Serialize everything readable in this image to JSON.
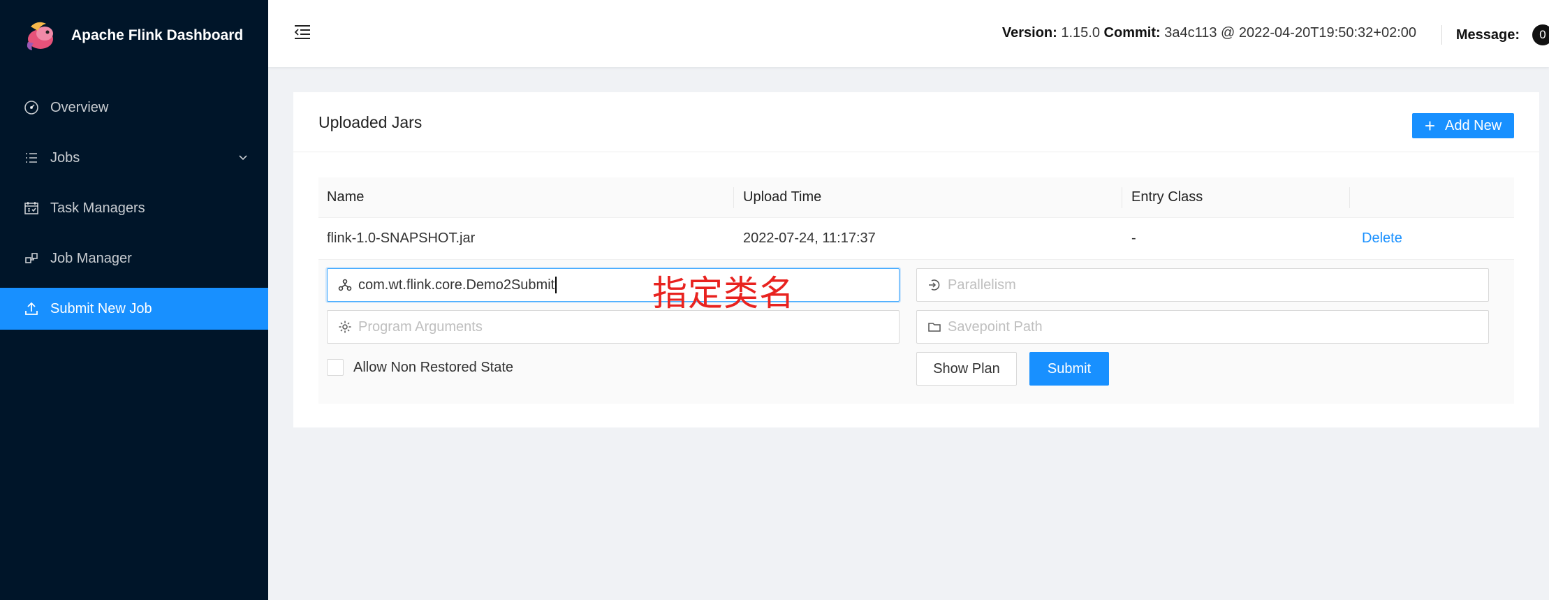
{
  "app": {
    "title": "Apache Flink Dashboard"
  },
  "sidebar": {
    "items": [
      {
        "label": "Overview",
        "icon": "dashboard-icon"
      },
      {
        "label": "Jobs",
        "icon": "list-icon"
      },
      {
        "label": "Task Managers",
        "icon": "schedule-icon"
      },
      {
        "label": "Job Manager",
        "icon": "cluster-icon"
      },
      {
        "label": "Submit New Job",
        "icon": "upload-icon"
      }
    ]
  },
  "header": {
    "version_label": "Version:",
    "version_value": "1.15.0",
    "commit_label": "Commit:",
    "commit_value": "3a4c113 @ 2022-04-20T19:50:32+02:00",
    "message_label": "Message:",
    "message_count": "0"
  },
  "card": {
    "title": "Uploaded Jars",
    "add_new_label": "Add New"
  },
  "table": {
    "columns": [
      "Name",
      "Upload Time",
      "Entry Class",
      ""
    ],
    "rows": [
      {
        "name": "flink-1.0-SNAPSHOT.jar",
        "upload_time": "2022-07-24, 11:17:37",
        "entry_class": "-",
        "action": "Delete"
      }
    ]
  },
  "submit_form": {
    "entry_class_value": "com.wt.flink.core.Demo2Submit",
    "parallelism_placeholder": "Parallelism",
    "program_args_placeholder": "Program Arguments",
    "savepoint_placeholder": "Savepoint Path",
    "allow_non_restored_label": "Allow Non Restored State",
    "show_plan_label": "Show Plan",
    "submit_label": "Submit"
  },
  "annotation": "指定类名",
  "colors": {
    "sidebar_bg": "#001529",
    "primary": "#1890ff",
    "annotation": "#e8221f"
  }
}
